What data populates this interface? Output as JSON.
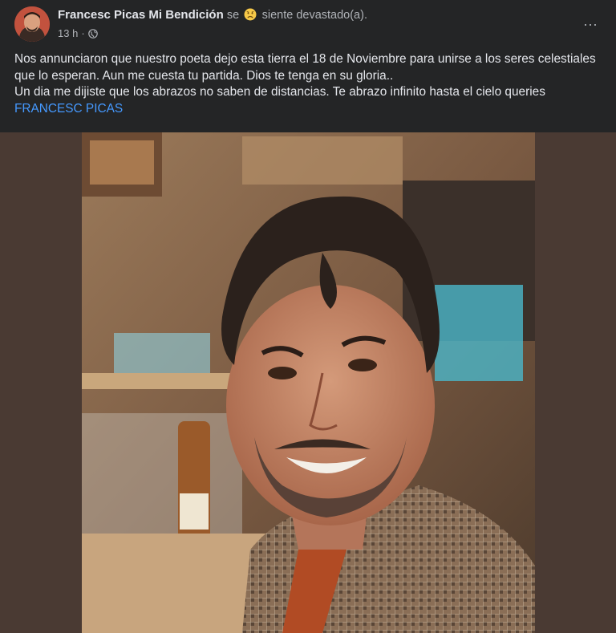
{
  "post": {
    "author": "Francesc Picas Mi Bendición",
    "feeling_prefix": "se",
    "feeling_text": "siente devastado(a).",
    "feeling_emoji": "sad-face-icon",
    "time": "13 h",
    "separator": "·",
    "privacy_icon": "globe-icon",
    "more_label": "···",
    "paragraph_1": "Nos annunciaron que nuestro poeta dejo esta tierra el 18 de Noviembre para unirse a los seres celestiales que lo esperan. Aun me cuesta tu partida. Dios te tenga en su gloria..",
    "paragraph_2": "Un dia me dijiste que los abrazos no saben de distancias. Te abrazo infinito hasta el cielo queries",
    "tagged_name": "FRANCESC PICAS"
  },
  "colors": {
    "background": "#242526",
    "photo_backdrop": "#4a3a33",
    "link": "#4599ff",
    "secondary_text": "#b0b3b8"
  }
}
